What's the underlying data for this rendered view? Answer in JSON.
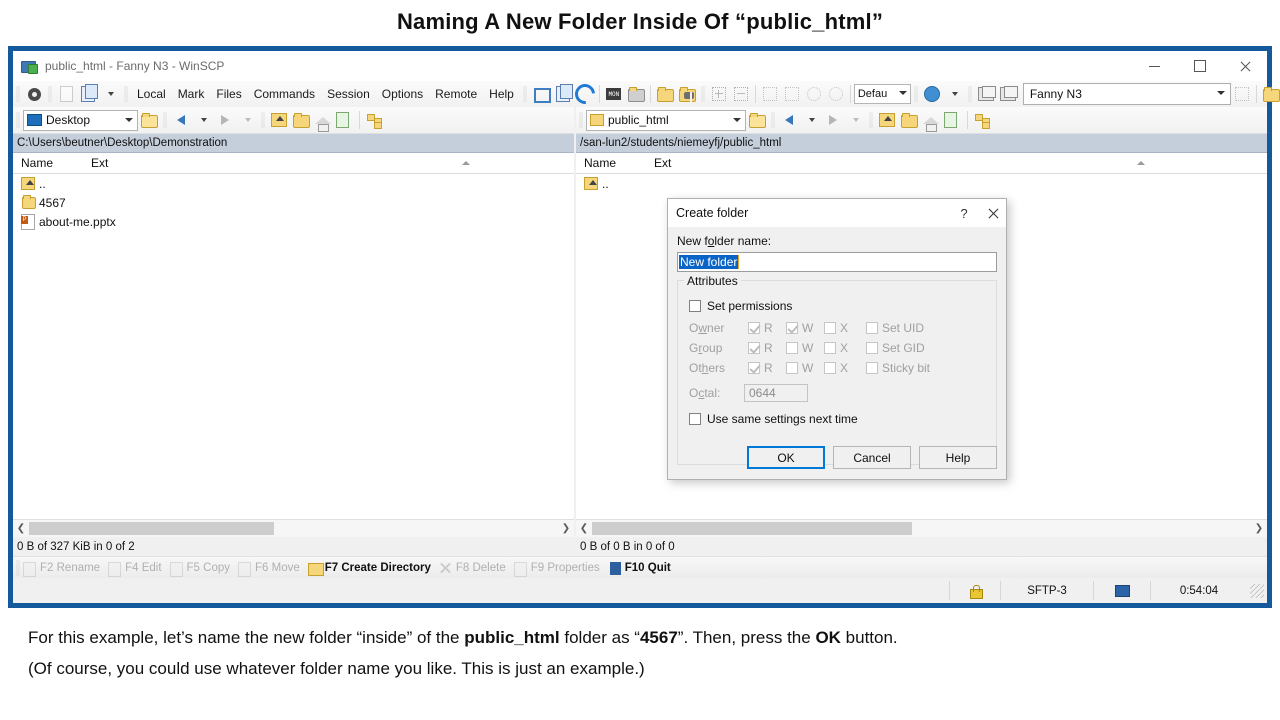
{
  "slide": {
    "title": "Naming A New Folder Inside Of “public_html”",
    "caption_line1_a": "For this example, let’s name the new folder “inside” of the ",
    "caption_line1_b": "public_html",
    "caption_line1_c": " folder as “",
    "caption_line1_d": "4567",
    "caption_line1_e": "”. Then, press the ",
    "caption_line1_f": "OK",
    "caption_line1_g": " button.",
    "caption_line2": "(Of course, you could use whatever folder name you like. This is just an example.)"
  },
  "window": {
    "title": "public_html - Fanny N3 - WinSCP",
    "icon": "winscp-lock-icon",
    "minimize": "─",
    "maximize": "□",
    "close": "✕"
  },
  "menubar": {
    "items": [
      {
        "label": "Local",
        "name": "menu-local"
      },
      {
        "label": "Mark",
        "name": "menu-mark"
      },
      {
        "label": "Files",
        "name": "menu-files"
      },
      {
        "label": "Commands",
        "name": "menu-commands"
      },
      {
        "label": "Session",
        "name": "menu-session"
      },
      {
        "label": "Options",
        "name": "menu-options"
      },
      {
        "label": "Remote",
        "name": "menu-remote"
      },
      {
        "label": "Help",
        "name": "menu-help"
      }
    ]
  },
  "toolbar": {
    "preferences_icon": "gear-icon",
    "log_icon": "session-log-icon",
    "copy_icon": "copy-documents-icon",
    "transfer_combo_value": "Defau",
    "session_name": "Fanny N3",
    "icons": [
      "open-session-icon",
      "new-session-tab-icon",
      "synchronize-browsing-icon",
      "console-icon",
      "open-terminal-icon",
      "synchronize-icon",
      "find-files-icon",
      "queue-add-icon",
      "queue-remove-icon",
      "filter-icon",
      "refresh-queue-icon",
      "stop-icon",
      "restart-icon",
      "globe-icon",
      "new-remote-file-icon",
      "properties-icon",
      "clear-session-icon",
      "save-session-icon",
      "save-workspace-icon"
    ]
  },
  "left_panel": {
    "drive_combo": "Desktop",
    "drive_icon": "desktop-icon",
    "path": "C:\\Users\\beutner\\Desktop\\Demonstration",
    "columns": [
      "Name",
      "Ext"
    ],
    "rows": [
      {
        "icon": "parent-directory-icon",
        "name": "..",
        "ext": ""
      },
      {
        "icon": "folder-icon",
        "name": "4567",
        "ext": ""
      },
      {
        "icon": "powerpoint-file-icon",
        "name": "about-me.pptx",
        "ext": ""
      }
    ],
    "status": "0 B of 327 KiB in 0 of 2"
  },
  "right_panel": {
    "drive_combo": "public_html",
    "drive_icon": "folder-icon",
    "path": "/san-lun2/students/niemeyfj/public_html",
    "columns": [
      "Name",
      "Ext"
    ],
    "rows": [
      {
        "icon": "parent-directory-icon",
        "name": "..",
        "ext": ""
      }
    ],
    "status": "0 B of 0 B in 0 of 0"
  },
  "function_keys": [
    {
      "label": "F2 Rename",
      "icon": "rename-icon",
      "enabled": false
    },
    {
      "label": "F4 Edit",
      "icon": "edit-icon",
      "enabled": false
    },
    {
      "label": "F5 Copy",
      "icon": "copy-icon",
      "enabled": false
    },
    {
      "label": "F6 Move",
      "icon": "move-icon",
      "enabled": false
    },
    {
      "label": "F7 Create Directory",
      "icon": "create-directory-icon",
      "enabled": true
    },
    {
      "label": "F8 Delete",
      "icon": "delete-icon",
      "enabled": false
    },
    {
      "label": "F9 Properties",
      "icon": "properties-icon",
      "enabled": false
    },
    {
      "label": "F10 Quit",
      "icon": "quit-icon",
      "enabled": true
    }
  ],
  "status_bar": {
    "lock_icon": "lock-icon",
    "protocol": "SFTP-3",
    "remote_icon": "remote-desktop-icon",
    "duration": "0:54:04"
  },
  "dialog": {
    "title": "Create folder",
    "help_glyph": "?",
    "close_glyph": "✕",
    "folder_name_label_pre": "New f",
    "folder_name_label_accel": "o",
    "folder_name_label_post": "lder name:",
    "folder_name_value": "New folder",
    "attributes_legend": "Attributes",
    "set_permissions_label": "Set permissions",
    "set_permissions_checked": false,
    "perm_rows": [
      {
        "label_pre": "O",
        "label_accel": "w",
        "label_post": "ner",
        "r": {
          "label": "R",
          "checked": true
        },
        "w": {
          "label": "W",
          "checked": true
        },
        "x": {
          "label": "X",
          "checked": false
        },
        "special": {
          "label": "Set UID",
          "checked": false
        }
      },
      {
        "label_pre": "G",
        "label_accel": "r",
        "label_post": "oup",
        "r": {
          "label": "R",
          "checked": true
        },
        "w": {
          "label": "W",
          "checked": false
        },
        "x": {
          "label": "X",
          "checked": false
        },
        "special": {
          "label": "Set GID",
          "checked": false
        }
      },
      {
        "label_pre": "Ot",
        "label_accel": "h",
        "label_post": "ers",
        "r": {
          "label": "R",
          "checked": true
        },
        "w": {
          "label": "W",
          "checked": false
        },
        "x": {
          "label": "X",
          "checked": false
        },
        "special": {
          "label": "Sticky bit",
          "checked": false
        }
      }
    ],
    "octal_label_pre": "O",
    "octal_label_accel": "c",
    "octal_label_post": "tal:",
    "octal_value": "0644",
    "use_same_settings_label": "Use same settings next time",
    "use_same_settings_checked": false,
    "buttons": {
      "ok": "OK",
      "cancel": "Cancel",
      "help": "Help"
    }
  },
  "colors": {
    "window_border": "#14599b",
    "path_bar": "#c5cedb",
    "selection_blue": "#0a64c8",
    "focus_blue": "#0078d7",
    "folder_yellow": "#f6d67a"
  }
}
